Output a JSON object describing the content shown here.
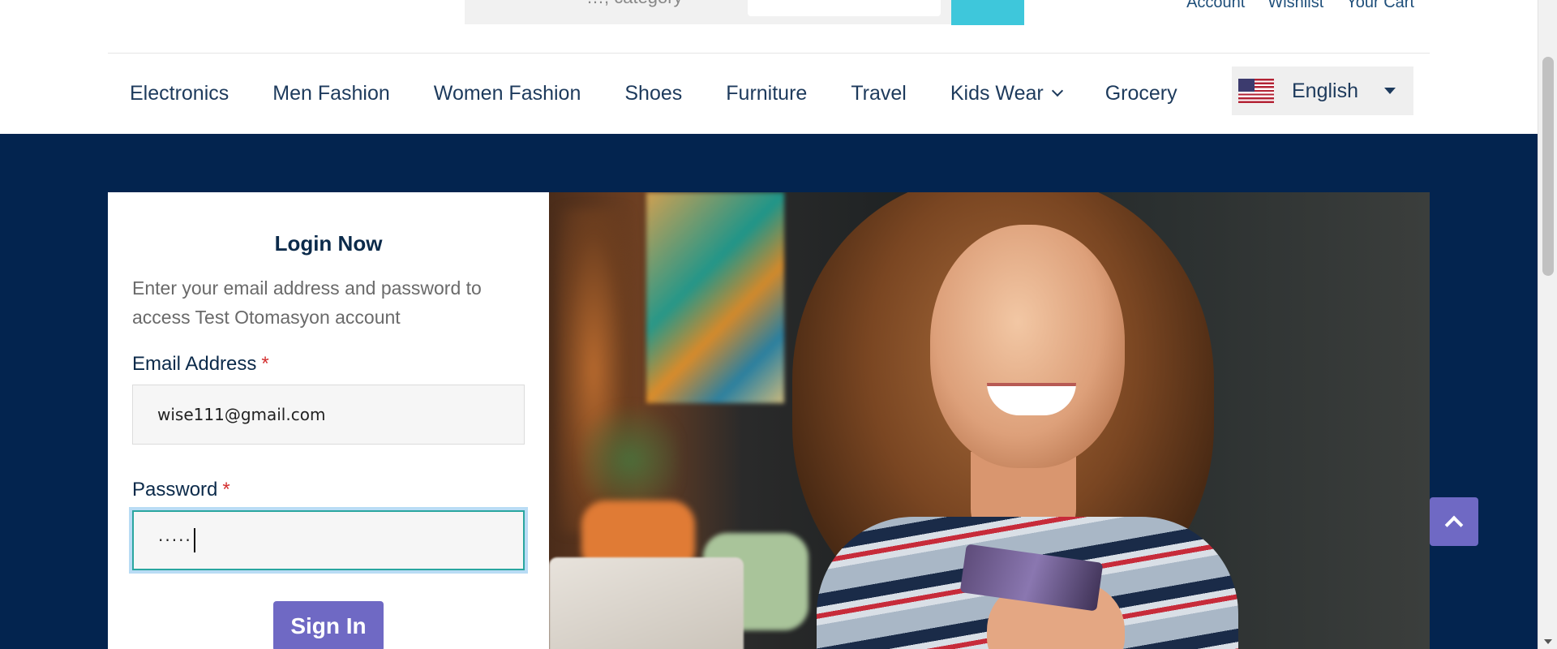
{
  "header": {
    "search_placeholder": "…, category",
    "top_links": [
      "Account",
      "Wishlist",
      "Your Cart"
    ]
  },
  "nav": {
    "items": [
      "Electronics",
      "Men Fashion",
      "Women Fashion",
      "Shoes",
      "Furniture",
      "Travel",
      "Kids Wear",
      "Grocery"
    ],
    "language": "English"
  },
  "login": {
    "title": "Login Now",
    "description": "Enter your email address and password to access Test Otomasyon account",
    "email_label": "Email Address",
    "email_value": "wise111@gmail.com",
    "password_label": "Password",
    "password_masked": "·····",
    "required_marker": "*",
    "signin_label": "Sign In"
  },
  "colors": {
    "dark_background": "#03244f",
    "accent_button": "#6f69c4",
    "search_button": "#3ec7db",
    "required": "#d32f2f"
  },
  "icons": {
    "back_to_top": "chevron-up-icon",
    "language_flag": "us-flag-icon",
    "dropdown": "caret-down-icon"
  }
}
